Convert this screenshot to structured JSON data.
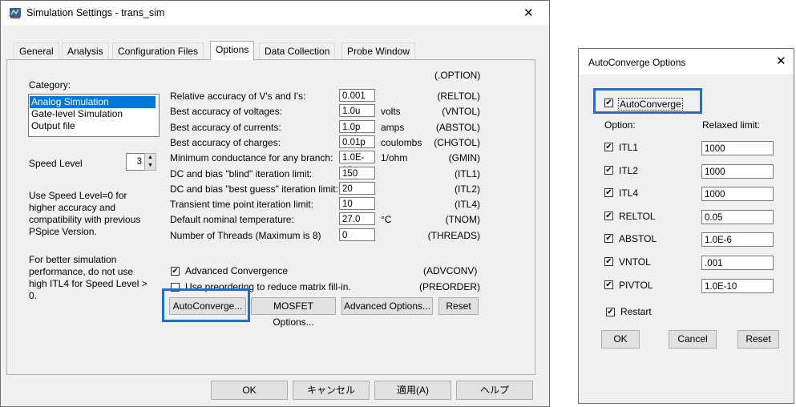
{
  "main_window": {
    "title": "Simulation Settings - trans_sim",
    "close_glyph": "✕",
    "tabs": [
      {
        "label": "General"
      },
      {
        "label": "Analysis"
      },
      {
        "label": "Configuration Files"
      },
      {
        "label": "Options",
        "active": true
      },
      {
        "label": "Data Collection"
      },
      {
        "label": "Probe Window"
      }
    ],
    "category_label": "Category:",
    "categories": [
      {
        "label": "Analog Simulation",
        "selected": true
      },
      {
        "label": "Gate-level Simulation"
      },
      {
        "label": "Output file"
      }
    ],
    "speed_level_label": "Speed Level",
    "speed_level_value": "3",
    "help_text_1": "Use Speed Level=0 for",
    "help_text_2": "higher accuracy and",
    "help_text_3": "compatibility with previous",
    "help_text_4": "PSpice Version.",
    "help_text_5": "For better simulation",
    "help_text_6": "performance, do not use",
    "help_text_7": "high ITL4 for Speed Level >",
    "help_text_8": "0.",
    "option_header": "(.OPTION)",
    "options": [
      {
        "label": "Relative accuracy of V's and I's:",
        "value": "0.001",
        "unit": "",
        "code": "(RELTOL)"
      },
      {
        "label": "Best accuracy of voltages:",
        "value": "1.0u",
        "unit": "volts",
        "code": "(VNTOL)"
      },
      {
        "label": "Best accuracy of currents:",
        "value": "1.0p",
        "unit": "amps",
        "code": "(ABSTOL)"
      },
      {
        "label": "Best accuracy of charges:",
        "value": "0.01p",
        "unit": "coulombs",
        "code": "(CHGTOL)"
      },
      {
        "label": "Minimum conductance for any branch:",
        "value": "1.0E-12",
        "unit": "1/ohm",
        "code": "(GMIN)"
      },
      {
        "label": "DC and bias \"blind\" iteration limit:",
        "value": "150",
        "unit": "",
        "code": "(ITL1)"
      },
      {
        "label": "DC and bias \"best guess\" iteration limit:",
        "value": "20",
        "unit": "",
        "code": "(ITL2)"
      },
      {
        "label": "Transient time point iteration limit:",
        "value": "10",
        "unit": "",
        "code": "(ITL4)"
      },
      {
        "label": "Default nominal temperature:",
        "value": "27.0",
        "unit": "°C",
        "code": "(TNOM)"
      },
      {
        "label": "Number of Threads (Maximum is 8)",
        "value": "0",
        "unit": "",
        "code": "(THREADS)"
      }
    ],
    "advanced_convergence_label": "Advanced Convergence",
    "advanced_convergence_checked": true,
    "advanced_convergence_code": "(ADVCONV)",
    "preordering_label": "Use preordering to reduce matrix fill-in.",
    "preordering_checked": false,
    "preordering_code": "(PREORDER)",
    "buttons": {
      "autoconverge": "AutoConverge...",
      "mosfet": "MOSFET Options...",
      "advanced": "Advanced Options...",
      "reset": "Reset"
    },
    "footer": {
      "ok": "OK",
      "cancel": "キャンセル",
      "apply": "適用(A)",
      "help": "ヘルプ"
    }
  },
  "autoconverge_dialog": {
    "title": "AutoConverge Options",
    "close_glyph": "✕",
    "autoconverge_label": "AutoConverge",
    "autoconverge_checked": true,
    "option_header": "Option:",
    "relaxed_header": "Relaxed limit:",
    "rows": [
      {
        "label": "ITL1",
        "checked": true,
        "value": "1000"
      },
      {
        "label": "ITL2",
        "checked": true,
        "value": "1000"
      },
      {
        "label": "ITL4",
        "checked": true,
        "value": "1000"
      },
      {
        "label": "RELTOL",
        "checked": true,
        "value": "0.05"
      },
      {
        "label": "ABSTOL",
        "checked": true,
        "value": "1.0E-6"
      },
      {
        "label": "VNTOL",
        "checked": true,
        "value": ".001"
      },
      {
        "label": "PIVTOL",
        "checked": true,
        "value": "1.0E-10"
      }
    ],
    "restart_label": "Restart",
    "restart_checked": true,
    "buttons": {
      "ok": "OK",
      "cancel": "Cancel",
      "reset": "Reset"
    }
  },
  "colors": {
    "highlight": "#1f6fd1",
    "selection": "#0078d7"
  }
}
